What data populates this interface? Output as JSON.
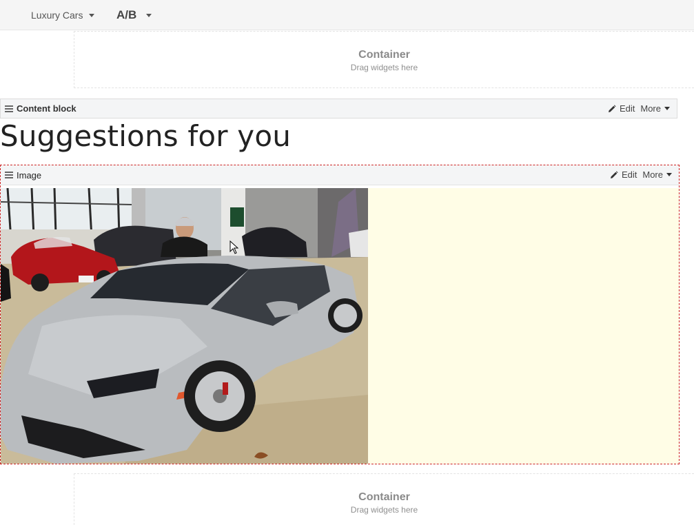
{
  "topbar": {
    "site_label": "Luxury Cars",
    "ab_label": "A/B"
  },
  "containers": {
    "top": {
      "title": "Container",
      "subtitle": "Drag widgets here"
    },
    "bottom": {
      "title": "Container",
      "subtitle": "Drag widgets here"
    }
  },
  "content_block": {
    "label": "Content block",
    "edit_label": "Edit",
    "more_label": "More",
    "heading": "Suggestions for you"
  },
  "image_widget": {
    "label": "Image",
    "edit_label": "Edit",
    "more_label": "More"
  },
  "colors": {
    "image_background": "#fffde6",
    "selection_border": "#cc2222",
    "car_body": "#b9bcbf",
    "red_car": "#b3161b"
  },
  "icons": [
    "hamburger-icon",
    "pencil-icon",
    "caret-down-icon"
  ]
}
